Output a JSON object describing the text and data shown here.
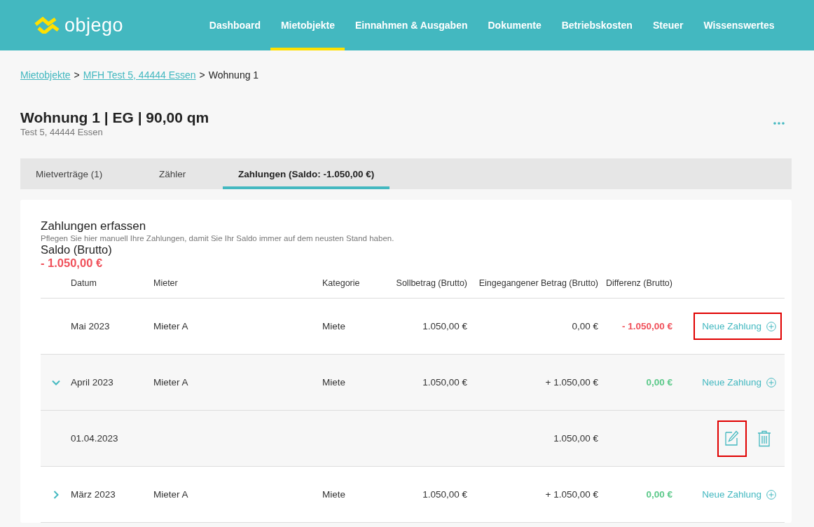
{
  "header": {
    "logo": "objego",
    "nav": [
      {
        "label": "Dashboard",
        "selected": false
      },
      {
        "label": "Mietobjekte",
        "selected": true
      },
      {
        "label": "Einnahmen & Ausgaben",
        "selected": false
      },
      {
        "label": "Dokumente",
        "selected": false
      },
      {
        "label": "Betriebskosten",
        "selected": false
      },
      {
        "label": "Steuer",
        "selected": false
      },
      {
        "label": "Wissenswertes",
        "selected": false
      }
    ]
  },
  "breadcrumb": {
    "links": [
      "Mietobjekte",
      "MFH Test 5, 44444 Essen"
    ],
    "separator": ">",
    "current": "Wohnung 1"
  },
  "page": {
    "title": "Wohnung 1 | EG | 90,00 qm",
    "subtitle": "Test 5, 44444 Essen"
  },
  "tabs": [
    {
      "label": "Mietverträge (1)",
      "selected": false
    },
    {
      "label": "Zähler",
      "selected": false
    },
    {
      "label": "Zahlungen (Saldo: -1.050,00 €)",
      "selected": true
    }
  ],
  "panel": {
    "title": "Zahlungen erfassen",
    "description": "Pflegen Sie hier manuell Ihre Zahlungen, damit Sie Ihr Saldo immer auf dem neusten Stand haben.",
    "saldo_label": "Saldo (Brutto)",
    "saldo_value": "- 1.050,00 €"
  },
  "table": {
    "columns": [
      "Datum",
      "Mieter",
      "Kategorie",
      "Sollbetrag (Brutto)",
      "Eingegangener Betrag (Brutto)",
      "Differenz (Brutto)"
    ],
    "rows": [
      {
        "kind": "month",
        "expandable": false,
        "expanded": false,
        "date": "Mai 2023",
        "tenant": "Mieter A",
        "category": "Miete",
        "target": "1.050,00 €",
        "received": "0,00 €",
        "difference": "- 1.050,00 €",
        "color": "#f0505a",
        "action": "Neue Zahlung",
        "highlighted": true
      },
      {
        "kind": "month",
        "expandable": true,
        "expanded": true,
        "date": "April 2023",
        "tenant": "Mieter A",
        "category": "Miete",
        "target": "1.050,00 €",
        "received": "+ 1.050,00 €",
        "difference": "0,00 €",
        "color": "#5cc98a",
        "action": "Neue Zahlung",
        "highlighted": false
      },
      {
        "kind": "payment",
        "date": "01.04.2023",
        "received": "1.050,00 €",
        "highlighted": true
      },
      {
        "kind": "month",
        "expandable": true,
        "expanded": false,
        "date": "März 2023",
        "tenant": "Mieter A",
        "category": "Miete",
        "target": "1.050,00 €",
        "received": "+ 1.050,00 €",
        "difference": "0,00 €",
        "color": "#5cc98a",
        "action": "Neue Zahlung",
        "highlighted": false
      }
    ]
  }
}
